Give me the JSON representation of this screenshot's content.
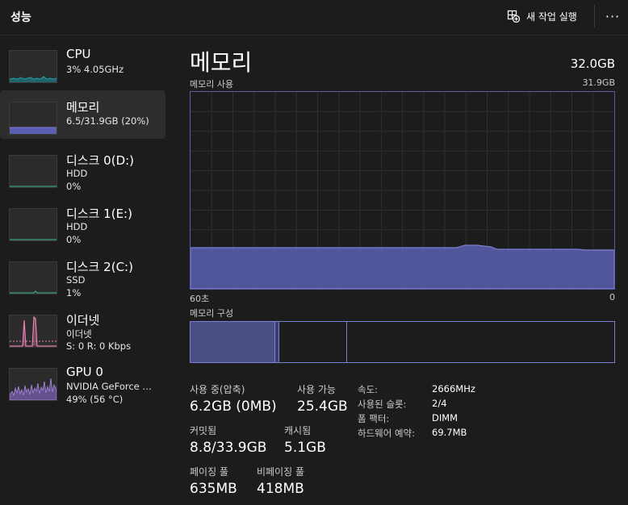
{
  "header": {
    "title": "성능",
    "run_task_label": "새 작업 실행",
    "more_label": "···"
  },
  "sidebar": {
    "items": [
      {
        "name": "CPU",
        "line1": "3% 4.05GHz",
        "line2": ""
      },
      {
        "name": "메모리",
        "line1": "6.5/31.9GB (20%)",
        "line2": ""
      },
      {
        "name": "디스크 0(D:)",
        "line1": "HDD",
        "line2": "0%"
      },
      {
        "name": "디스크 1(E:)",
        "line1": "HDD",
        "line2": "0%"
      },
      {
        "name": "디스크 2(C:)",
        "line1": "SSD",
        "line2": "1%"
      },
      {
        "name": "이더넷",
        "line1": "이더넷",
        "line2": "S: 0 R: 0 Kbps"
      },
      {
        "name": "GPU 0",
        "line1": "NVIDIA GeForce …",
        "line2": "49% (56 °C)"
      }
    ]
  },
  "main": {
    "title": "메모리",
    "capacity": "32.0GB",
    "graph_label": "메모리 사용",
    "graph_max": "31.9GB",
    "graph_left": "60초",
    "graph_right": "0",
    "composition_label": "메모리 구성",
    "composition": {
      "in_use_fraction": 0.2,
      "modified_fraction": 0.01,
      "standby_fraction": 0.16
    },
    "stats": {
      "in_use_label": "사용 중(압축)",
      "in_use_value": "6.2GB (0MB)",
      "available_label": "사용 가능",
      "available_value": "25.4GB",
      "committed_label": "커밋됨",
      "committed_value": "8.8/33.9GB",
      "cached_label": "캐시됨",
      "cached_value": "5.1GB",
      "paged_label": "페이징 풀",
      "paged_value": "635MB",
      "nonpaged_label": "비페이징 풀",
      "nonpaged_value": "418MB"
    },
    "specs": {
      "speed_label": "속도:",
      "speed_value": "2666MHz",
      "slots_label": "사용된 슬롯:",
      "slots_value": "2/4",
      "form_label": "폼 팩터:",
      "form_value": "DIMM",
      "reserved_label": "하드웨어 예약:",
      "reserved_value": "69.7MB"
    }
  },
  "colors": {
    "accent": "#7b7fd4",
    "memory_fill": "#5b5fb0",
    "cpu": "#1aa0a8",
    "disk": "#3bbf9a",
    "ethernet": "#e87fb0",
    "gpu": "#8a6ad0"
  }
}
